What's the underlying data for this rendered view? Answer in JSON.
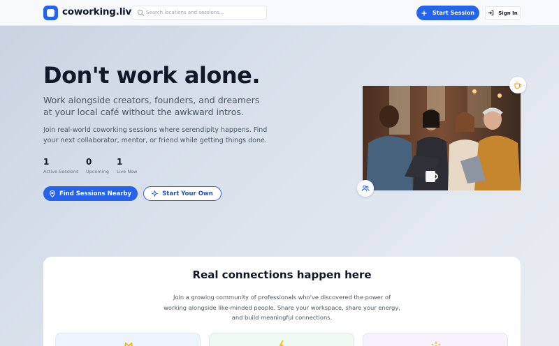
{
  "header": {
    "brand": "coworking.live",
    "search_placeholder": "Search locations and sessions...",
    "start_session_label": "Start Session",
    "sign_in_label": "Sign In"
  },
  "hero": {
    "title": "Don't work alone.",
    "subtitle": "Work alongside creators, founders, and dreamers at your local café without the awkward intros.",
    "body": "Join real-world coworking sessions where serendipity happens. Find your next collaborator, mentor, or friend while getting things done.",
    "stats": [
      {
        "value": "1",
        "label": "Active Sessions"
      },
      {
        "value": "0",
        "label": "Upcoming"
      },
      {
        "value": "1",
        "label": "Live Now"
      }
    ],
    "find_button_label": "Find Sessions Nearby",
    "own_button_label": "Start Your Own"
  },
  "connections": {
    "title": "Real connections happen here",
    "text": "Join a growing community of professionals who've discovered the power of working alongside like-minded people. Share your workspace, share your energy, and build meaningful connections."
  },
  "colors": {
    "accent": "#2563eb",
    "feature_1_bg": "#eef4ff",
    "feature_2_bg": "#effaf3",
    "feature_3_bg": "#f7f2fd"
  },
  "icons": {
    "logo": "logo-icon",
    "search": "search-icon",
    "plus": "plus-icon",
    "sign_in": "sign-in-icon",
    "location": "map-pin-icon",
    "sparkle": "sparkle-icon",
    "coffee": "coffee-icon",
    "people": "users-icon"
  }
}
